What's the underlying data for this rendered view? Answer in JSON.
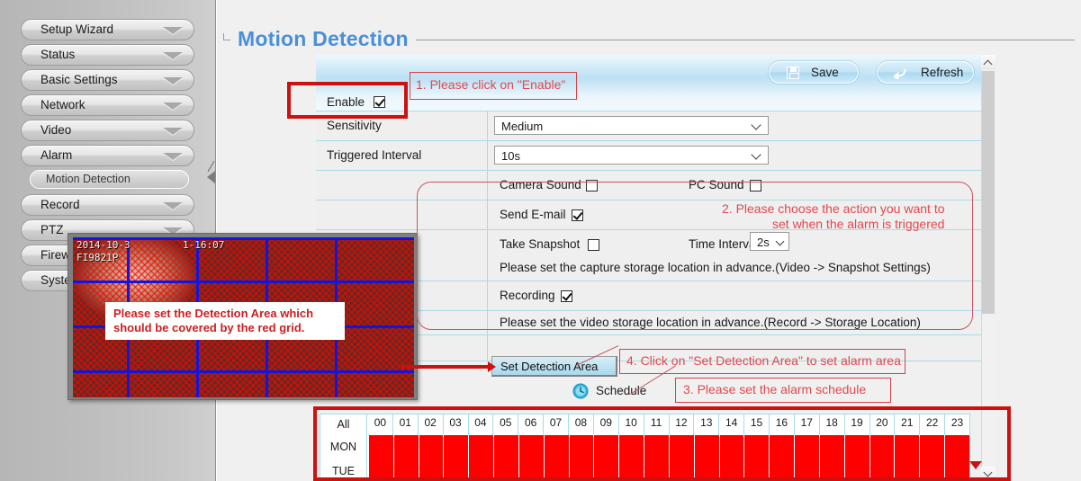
{
  "sidebar": {
    "items": [
      {
        "label": "Setup Wizard",
        "type": "group"
      },
      {
        "label": "Status",
        "type": "group"
      },
      {
        "label": "Basic Settings",
        "type": "group"
      },
      {
        "label": "Network",
        "type": "group"
      },
      {
        "label": "Video",
        "type": "group"
      },
      {
        "label": "Alarm",
        "type": "group"
      },
      {
        "label": "Motion Detection",
        "type": "sub",
        "selected": true
      },
      {
        "label": "Record",
        "type": "group"
      },
      {
        "label": "PTZ",
        "type": "group"
      },
      {
        "label": "Firewall",
        "type": "group"
      },
      {
        "label": "System",
        "type": "group"
      }
    ]
  },
  "page": {
    "title": "Motion Detection"
  },
  "toolbar": {
    "save_label": "Save",
    "refresh_label": "Refresh",
    "save_icon": "floppy-icon",
    "refresh_icon": "refresh-icon"
  },
  "form": {
    "enable_label": "Enable",
    "enable_checked": true,
    "sensitivity_label": "Sensitivity",
    "sensitivity_value": "Medium",
    "triggered_interval_label": "Triggered Interval",
    "triggered_interval_value": "10s",
    "camera_sound_label": "Camera Sound",
    "camera_sound_checked": false,
    "pc_sound_label": "PC Sound",
    "pc_sound_checked": false,
    "send_email_label": "Send E-mail",
    "send_email_checked": true,
    "take_snapshot_label": "Take Snapshot",
    "take_snapshot_checked": false,
    "time_interval_label": "Time Interval",
    "time_interval_value": "2s",
    "snapshot_hint": "Please set the capture storage location in advance.(Video -> Snapshot Settings)",
    "recording_label": "Recording",
    "recording_checked": true,
    "recording_hint": "Please set the video storage location in advance.(Record -> Storage Location)",
    "set_detection_area_label": "Set Detection Area",
    "schedule_label": "Schedule",
    "schedule_icon": "clock-icon"
  },
  "schedule": {
    "all_label": "All",
    "hours": [
      "00",
      "01",
      "02",
      "03",
      "04",
      "05",
      "06",
      "07",
      "08",
      "09",
      "10",
      "11",
      "12",
      "13",
      "14",
      "15",
      "16",
      "17",
      "18",
      "19",
      "20",
      "21",
      "22",
      "23"
    ],
    "rows": [
      {
        "day": "MON",
        "active": true
      },
      {
        "day": "TUE",
        "active": true
      }
    ],
    "active_color": "#ff0000"
  },
  "video_preview": {
    "osd_date": "2014-10-3",
    "osd_time": "1-16:07",
    "osd_model": "FI9821P",
    "note_line1": "Please set the Detection Area which",
    "note_line2": "should be covered by the red grid.",
    "grid_color": "#1414e0",
    "mesh_color": "#ff0000"
  },
  "annotations": {
    "step1": "1. Please click on \"Enable\"",
    "step2_line1": "2. Please choose the action you want to",
    "step2_line2": "set when the alarm is triggered",
    "step3": "3. Please set the alarm schedule",
    "step4": "4. Click on \"Set Detection Area\" to set alarm area",
    "color": "#e0484f",
    "box_color": "#cc1111"
  },
  "colors": {
    "title": "#4a90d9",
    "table_border": "#a9dbe8",
    "panel_bg": "#f0f0f0",
    "sidebar_bg": "#c0c0c0"
  }
}
